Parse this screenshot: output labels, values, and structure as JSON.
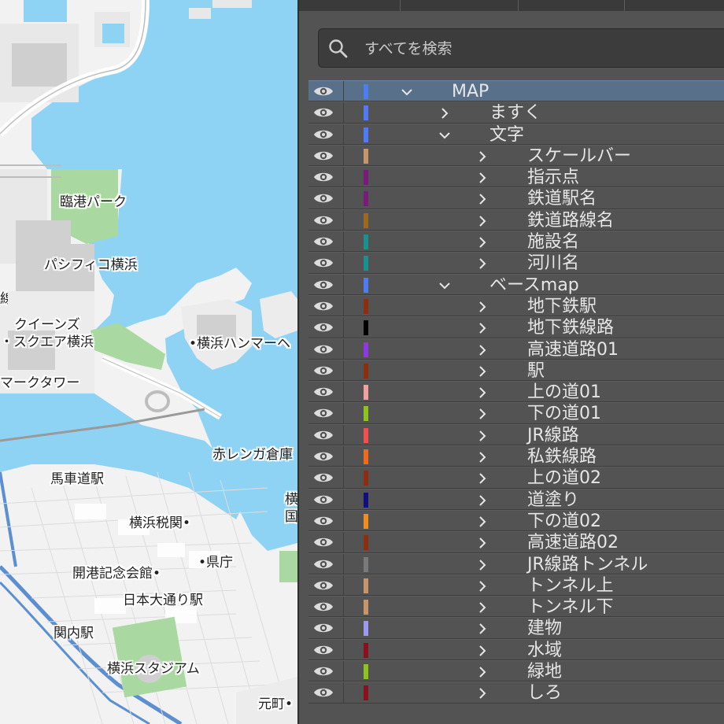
{
  "map": {
    "labels": [
      {
        "id": "rinko-park",
        "text": "臨港パーク"
      },
      {
        "id": "pacifico",
        "text": "パシフィコ横浜"
      },
      {
        "id": "queens-1",
        "text": "クイーンズ"
      },
      {
        "id": "queens-2",
        "text": "・スクエア横浜"
      },
      {
        "id": "landmark",
        "text": "マークタワー"
      },
      {
        "id": "hammerhead",
        "text": "•横浜ハンマーヘ"
      },
      {
        "id": "akarenga",
        "text": "赤レンガ倉庫"
      },
      {
        "id": "bashamichi",
        "text": "馬車道駅"
      },
      {
        "id": "zeikan",
        "text": "横浜税関•"
      },
      {
        "id": "kencho",
        "text": "•県庁"
      },
      {
        "id": "kaiko",
        "text": "開港記念会館•"
      },
      {
        "id": "nihon-odori",
        "text": "日本大通り駅"
      },
      {
        "id": "kannai",
        "text": "関内駅"
      },
      {
        "id": "stadium",
        "text": "横浜スタジアム"
      },
      {
        "id": "motomachi",
        "text": "元町•"
      },
      {
        "id": "edge-sen",
        "text": "線"
      },
      {
        "id": "edge-yoko",
        "text": "横"
      },
      {
        "id": "edge-koku",
        "text": "国"
      }
    ]
  },
  "panel": {
    "search": {
      "placeholder": "すべてを検索"
    },
    "layers": [
      {
        "name": "MAP",
        "color": "#4f7cf0",
        "level": 0,
        "expanded": true,
        "selected": true
      },
      {
        "name": "ますく",
        "color": "#4f7cf0",
        "level": 1,
        "expanded": false
      },
      {
        "name": "文字",
        "color": "#4f7cf0",
        "level": 1,
        "expanded": true
      },
      {
        "name": "スケールバー",
        "color": "#c8956a",
        "level": 2,
        "expanded": false
      },
      {
        "name": "指示点",
        "color": "#7a1a7a",
        "level": 2,
        "expanded": false
      },
      {
        "name": "鉄道駅名",
        "color": "#7a1a7a",
        "level": 2,
        "expanded": false
      },
      {
        "name": "鉄道路線名",
        "color": "#9c6a1e",
        "level": 2,
        "expanded": false
      },
      {
        "name": "施設名",
        "color": "#1a9090",
        "level": 2,
        "expanded": false
      },
      {
        "name": "河川名",
        "color": "#1a9090",
        "level": 2,
        "expanded": false
      },
      {
        "name": "ベースmap",
        "color": "#4f7cf0",
        "level": 1,
        "expanded": true
      },
      {
        "name": "地下鉄駅",
        "color": "#8c2f10",
        "level": 2,
        "expanded": false
      },
      {
        "name": "地下鉄線路",
        "color": "#000000",
        "level": 2,
        "expanded": false
      },
      {
        "name": "高速道路01",
        "color": "#8a3ae0",
        "level": 2,
        "expanded": false
      },
      {
        "name": "駅",
        "color": "#8c2f10",
        "level": 2,
        "expanded": false
      },
      {
        "name": "上の道01",
        "color": "#f0a0a0",
        "level": 2,
        "expanded": false
      },
      {
        "name": "下の道01",
        "color": "#8ec21e",
        "level": 2,
        "expanded": false
      },
      {
        "name": "JR線路",
        "color": "#f05050",
        "level": 2,
        "expanded": false
      },
      {
        "name": "私鉄線路",
        "color": "#f06a1e",
        "level": 2,
        "expanded": false
      },
      {
        "name": "上の道02",
        "color": "#8c2f10",
        "level": 2,
        "expanded": false
      },
      {
        "name": "道塗り",
        "color": "#10107a",
        "level": 2,
        "expanded": false
      },
      {
        "name": "下の道02",
        "color": "#f08c1e",
        "level": 2,
        "expanded": false
      },
      {
        "name": "高速道路02",
        "color": "#8c2f10",
        "level": 2,
        "expanded": false
      },
      {
        "name": "JR線路トンネル",
        "color": "#7a7a7a",
        "level": 2,
        "expanded": false
      },
      {
        "name": "トンネル上",
        "color": "#c8956a",
        "level": 2,
        "expanded": false
      },
      {
        "name": "トンネル下",
        "color": "#c8956a",
        "level": 2,
        "expanded": false
      },
      {
        "name": "建物",
        "color": "#9a9af0",
        "level": 2,
        "expanded": false
      },
      {
        "name": "水域",
        "color": "#8a1020",
        "level": 2,
        "expanded": false
      },
      {
        "name": "緑地",
        "color": "#8ec21e",
        "level": 2,
        "expanded": false
      },
      {
        "name": "しろ",
        "color": "#8a1020",
        "level": 2,
        "expanded": false
      }
    ]
  },
  "colors": {
    "water": "#8fd3f4",
    "land": "#f2f2f2",
    "park": "#a9d8a0",
    "building": "#d0d0d0",
    "rail": "#5b8fd0",
    "panel_bg": "#535353",
    "selection": "#59708a"
  }
}
